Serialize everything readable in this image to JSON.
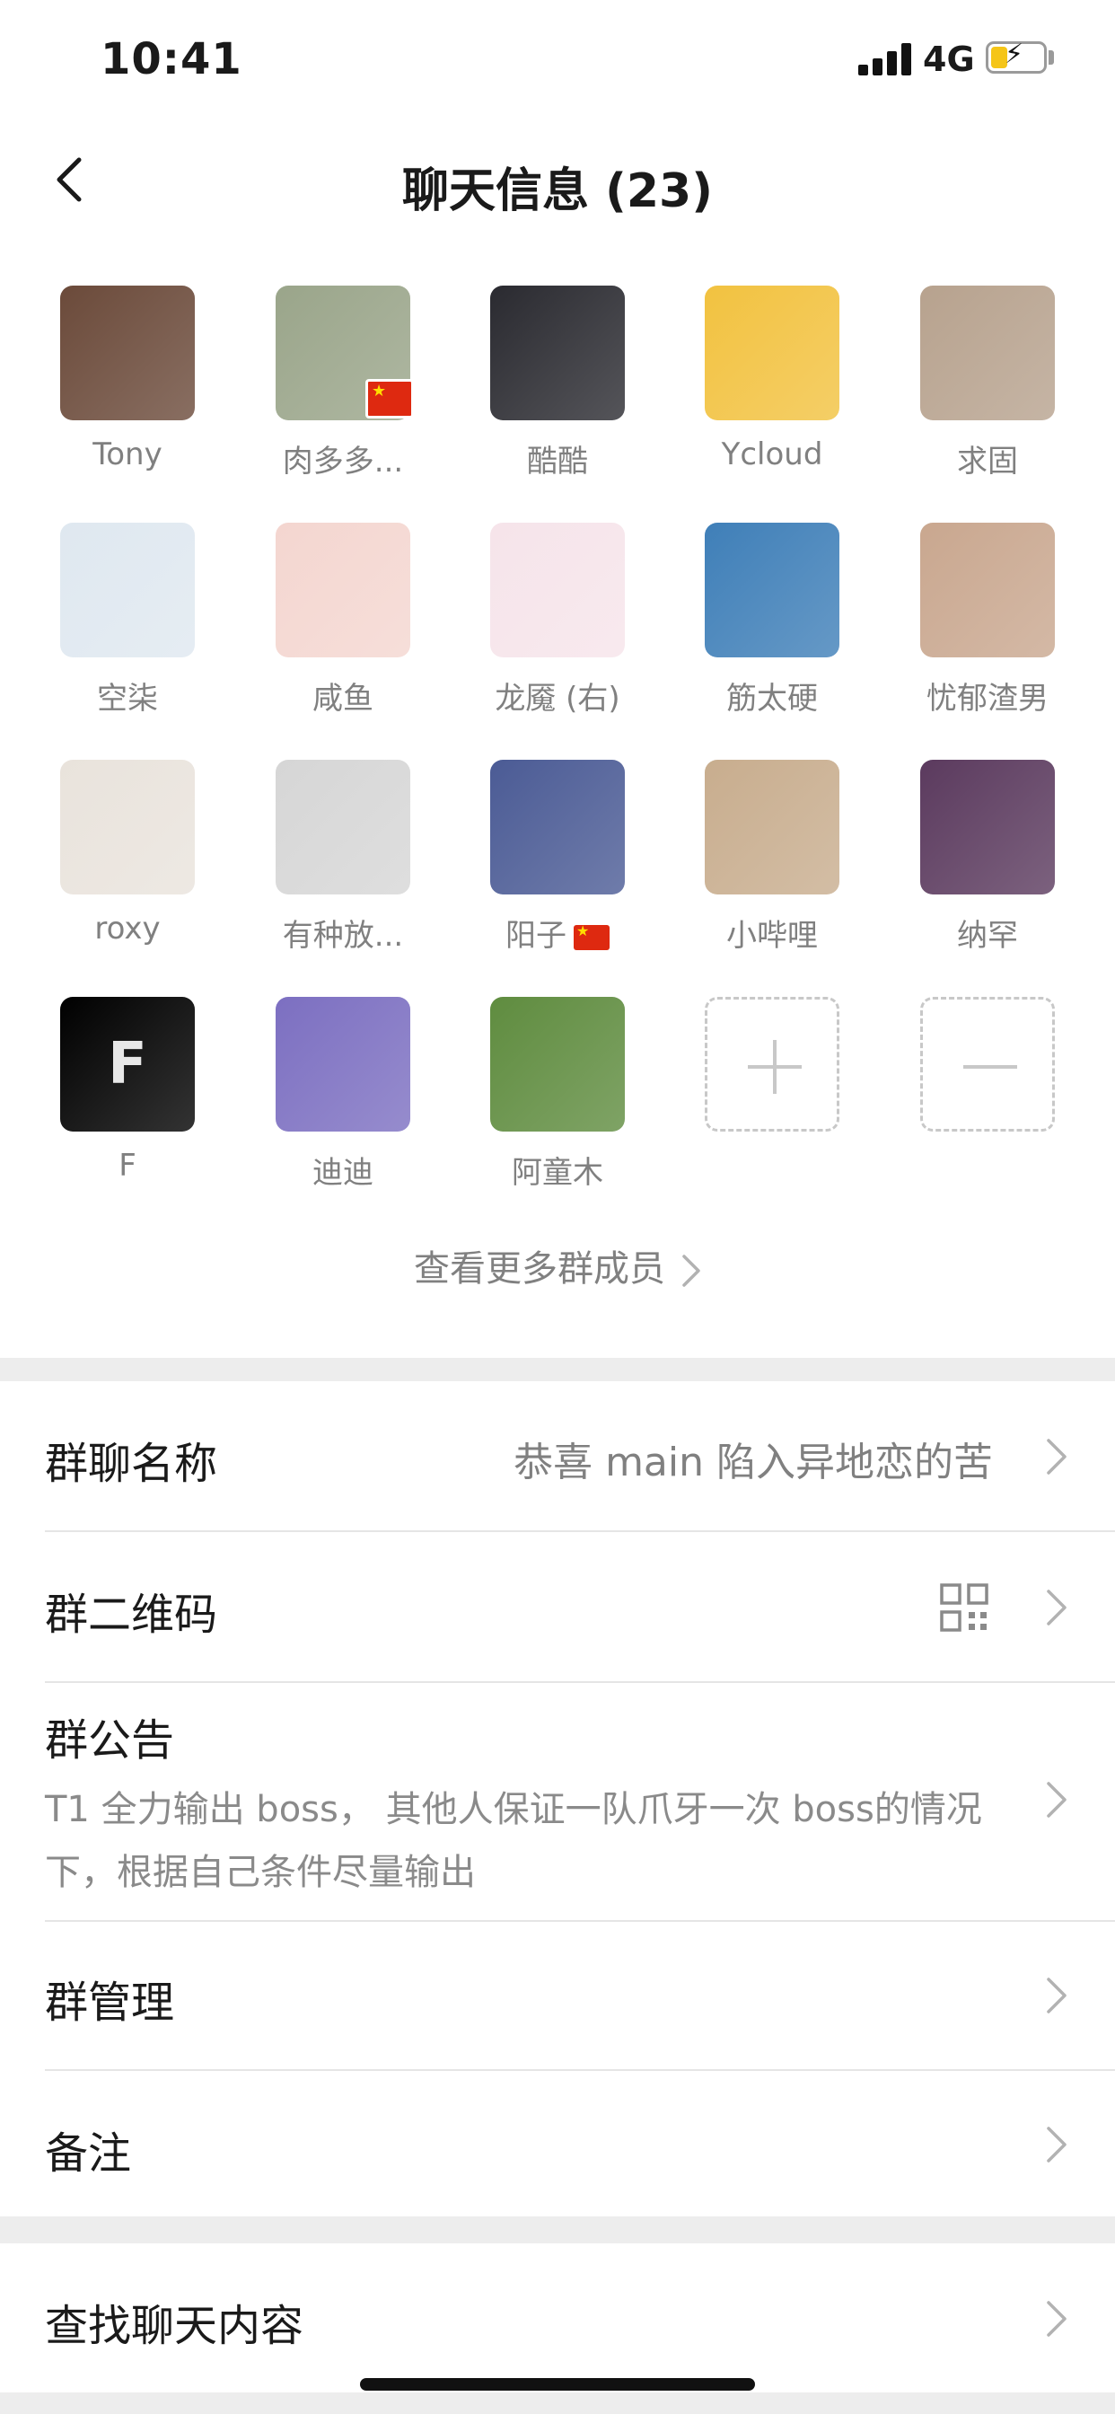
{
  "status_bar": {
    "time": "10:41",
    "network": "4G"
  },
  "nav": {
    "title": "聊天信息 (23)"
  },
  "members": [
    {
      "name": "Tony",
      "color": "#6b4a3a"
    },
    {
      "name": "肉多多...",
      "color": "#9aa58a",
      "badge": "china-flag"
    },
    {
      "name": "酷酷",
      "color": "#2a2a30"
    },
    {
      "name": "Ycloud",
      "color": "#f2c240"
    },
    {
      "name": "求固",
      "color": "#b7a28e"
    },
    {
      "name": "空柒",
      "color": "#dfe8f0"
    },
    {
      "name": "咸鱼",
      "color": "#f4d6d0"
    },
    {
      "name": "龙魇 (右)",
      "color": "#f6e4ea"
    },
    {
      "name": "筋太硬",
      "color": "#3f7fb8"
    },
    {
      "name": "忧郁渣男",
      "color": "#c9a78f"
    },
    {
      "name": "roxy",
      "color": "#e9e3dc"
    },
    {
      "name": "有种放...",
      "color": "#d6d6d6"
    },
    {
      "name": "阳子",
      "color": "#4b5b95",
      "name_flag": true
    },
    {
      "name": "小哔哩",
      "color": "#c8ad8e"
    },
    {
      "name": "纳罕",
      "color": "#5b3a5e"
    },
    {
      "name": "F",
      "color": "#000000",
      "glyph": "F"
    },
    {
      "name": "迪迪",
      "color": "#7c6fc1"
    },
    {
      "name": "阿童木",
      "color": "#5f8c3f"
    }
  ],
  "member_actions": {
    "add": "add-member",
    "remove": "remove-member"
  },
  "more_members_label": "查看更多群成员",
  "settings": {
    "group_name_label": "群聊名称",
    "group_name_value": "恭喜 main 陷入异地恋的苦",
    "qr_label": "群二维码",
    "announcement_label": "群公告",
    "announcement_text": "T1 全力输出 boss， 其他人保证一队爪牙一次 boss的情况下，根据自己条件尽量输出",
    "manage_label": "群管理",
    "remark_label": "备注",
    "search_label": "查找聊天内容"
  },
  "colors": {
    "background": "#ededed",
    "card": "#ffffff",
    "secondary_text": "#808080",
    "flag_red": "#de2910"
  }
}
